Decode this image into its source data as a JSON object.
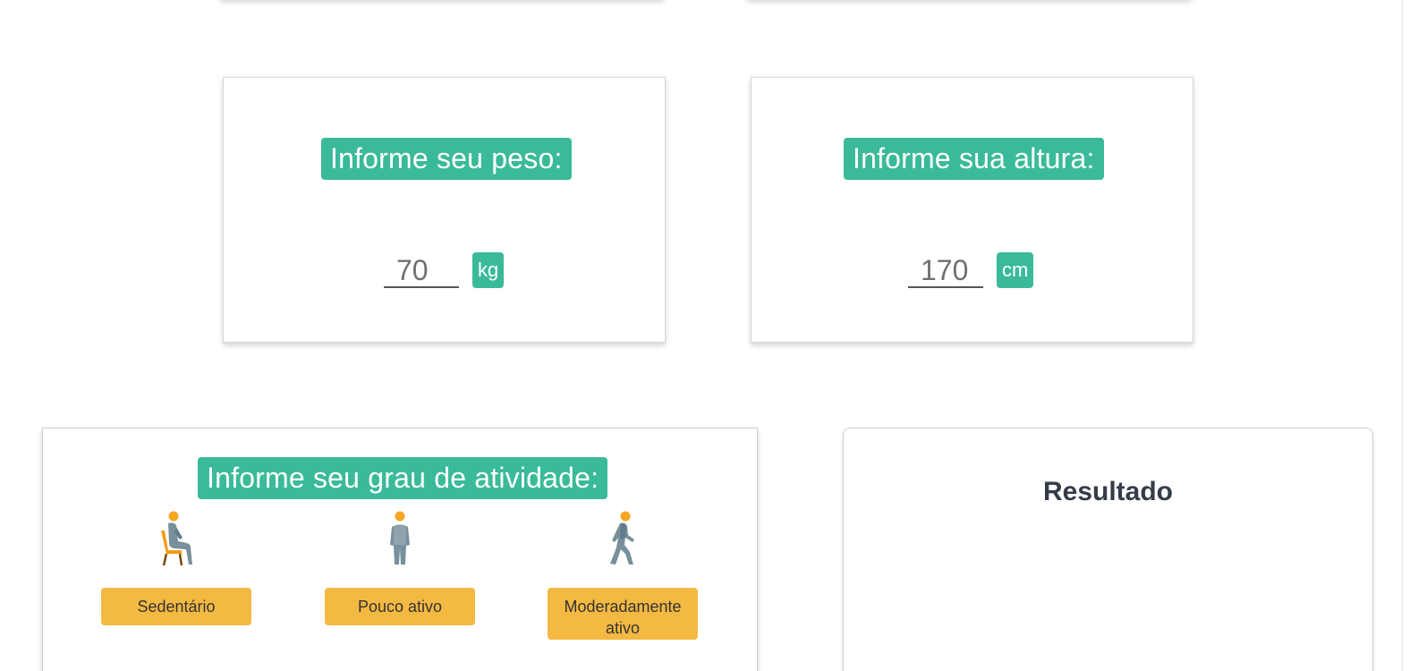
{
  "weight": {
    "label": "Informe seu peso:",
    "value": "70",
    "unit": "kg"
  },
  "height": {
    "label": "Informe sua altura:",
    "value": "170",
    "unit": "cm"
  },
  "activity": {
    "label": "Informe seu grau de atividade:",
    "options": [
      {
        "label": "Sedentário",
        "icon": "person-sitting-icon"
      },
      {
        "label": "Pouco ativo",
        "icon": "person-standing-icon"
      },
      {
        "label": "Moderadamente ativo",
        "icon": "person-walking-icon"
      }
    ]
  },
  "result": {
    "title": "Resultado"
  },
  "colors": {
    "accent_green": "#3aba99",
    "button_yellow": "#f4b942",
    "result_text": "#353c48"
  }
}
